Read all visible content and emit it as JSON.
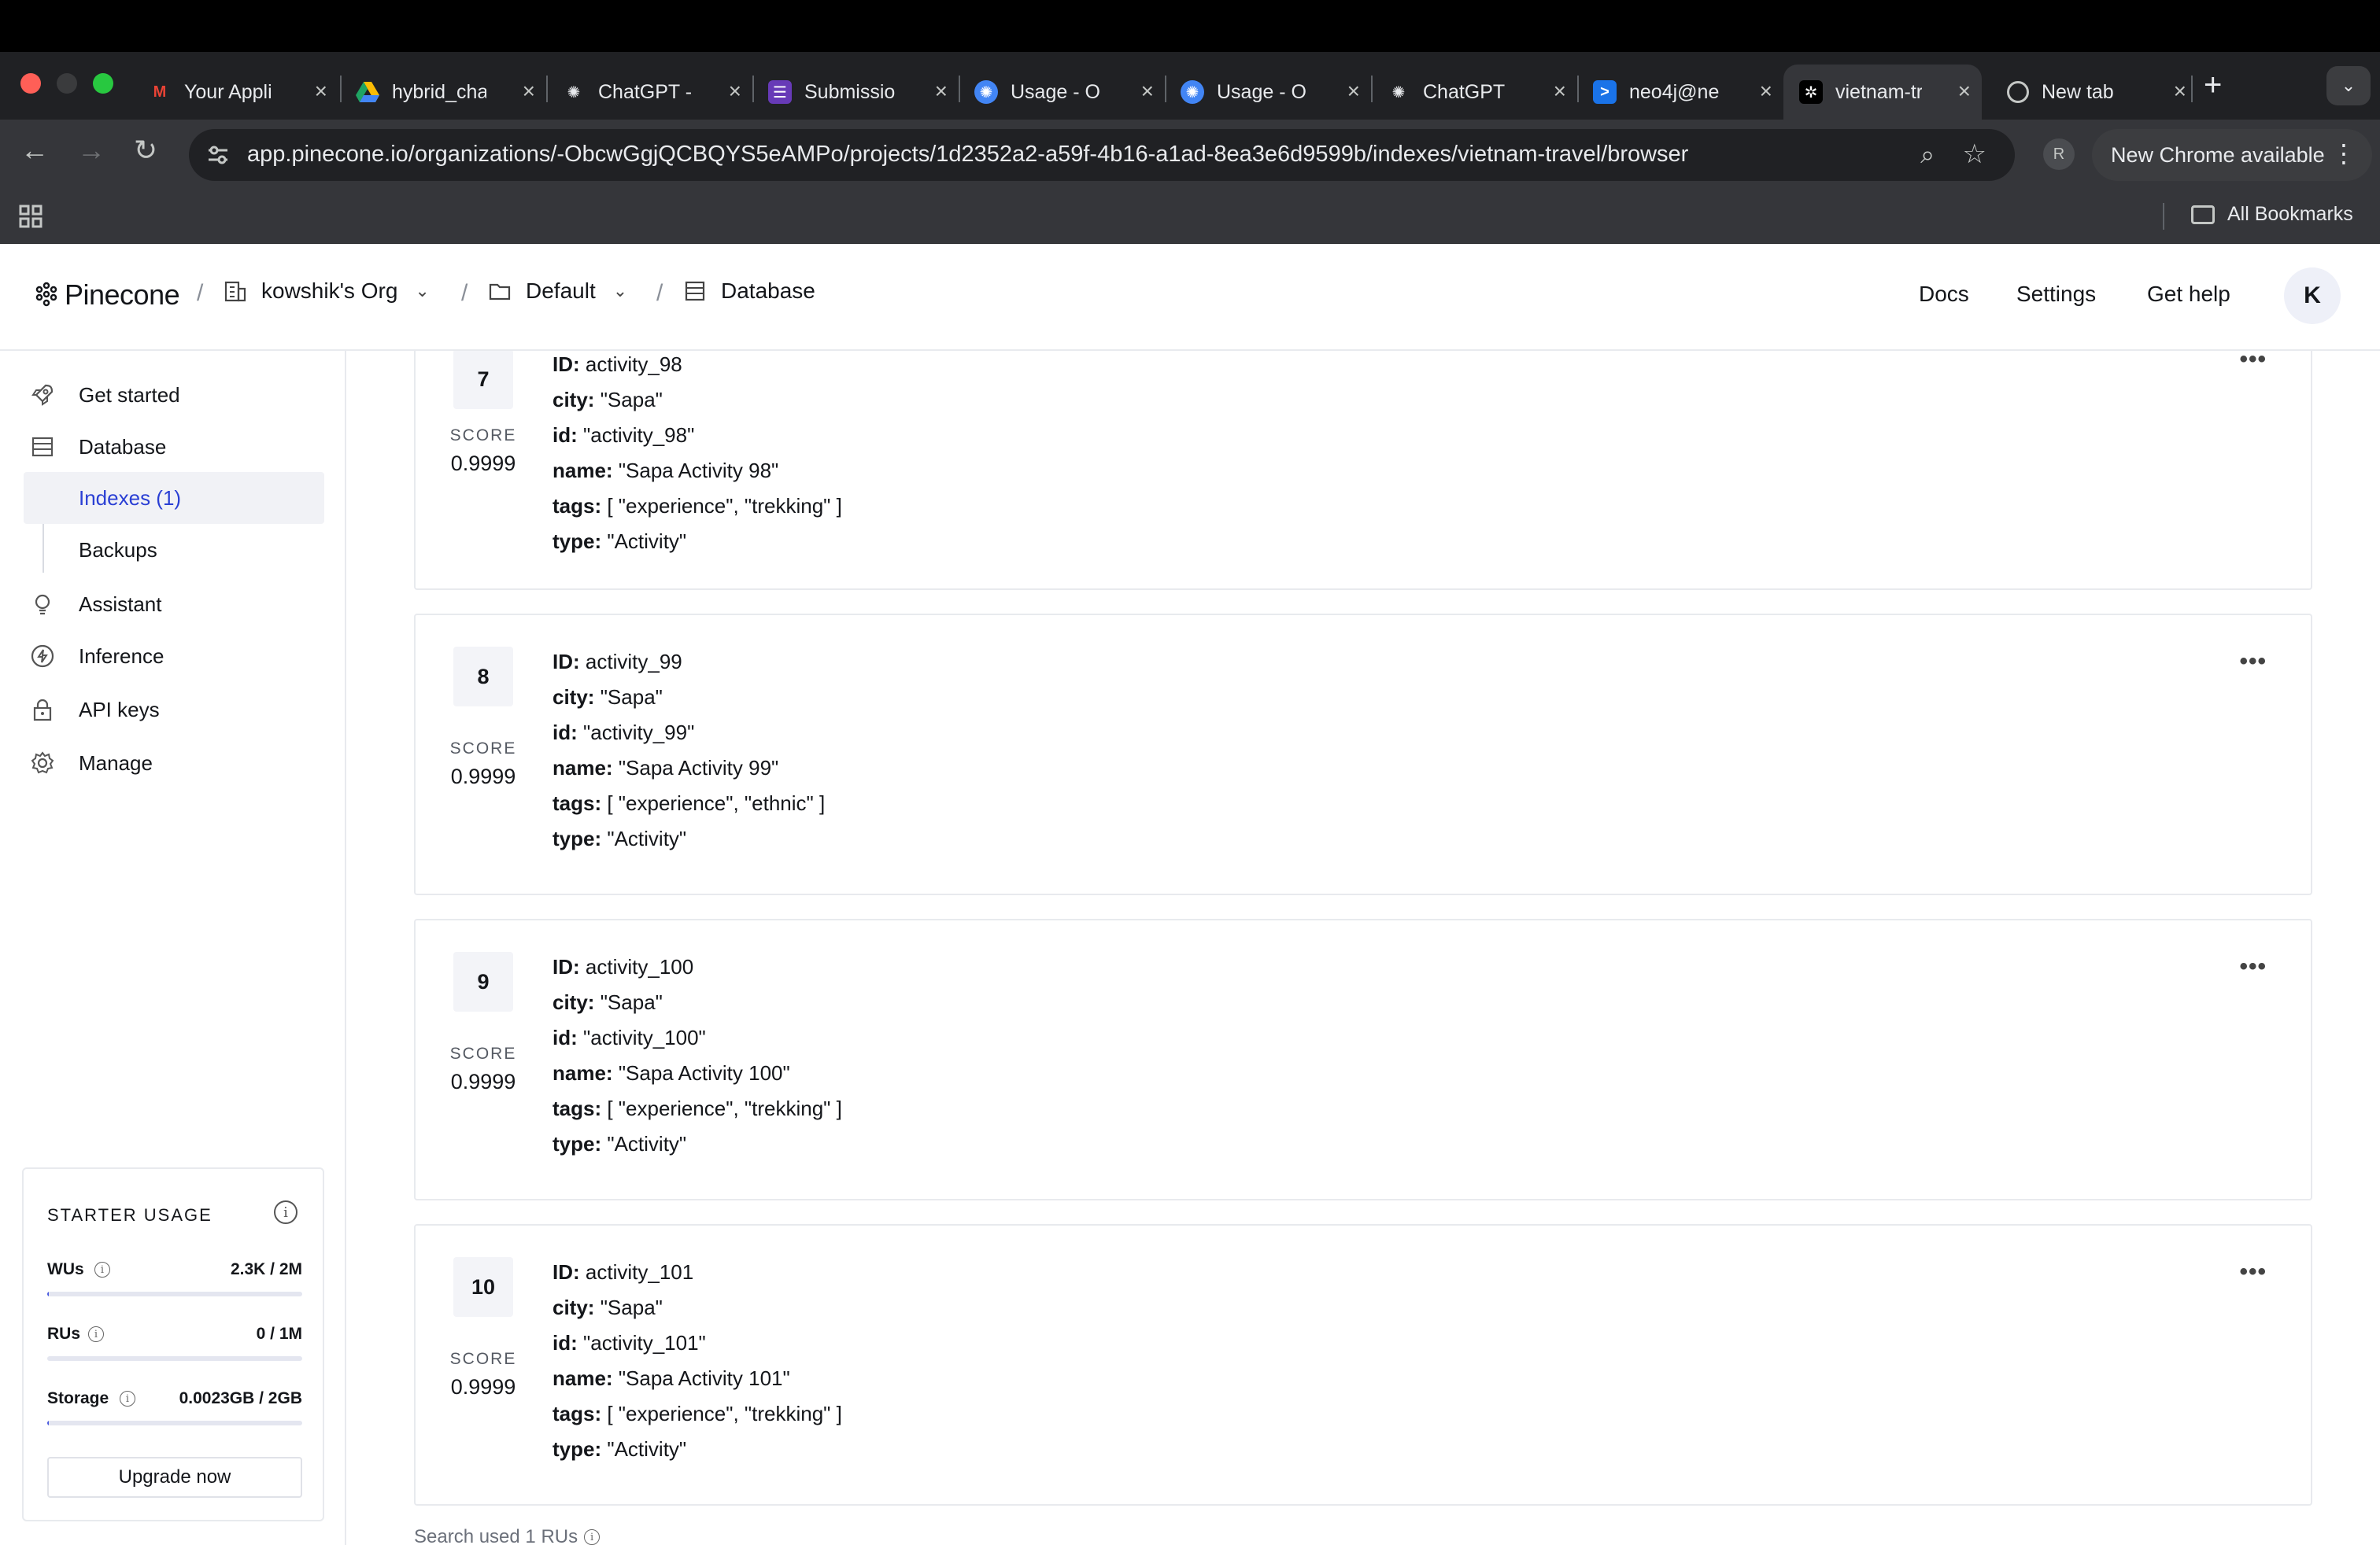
{
  "browser": {
    "tabs": [
      {
        "label": "Your Appli",
        "icon": "gmail-icon",
        "color": "#ea4335"
      },
      {
        "label": "hybrid_cha",
        "icon": "google-drive-icon",
        "color": "#1fa463"
      },
      {
        "label": "ChatGPT -",
        "icon": "chatgpt-icon",
        "color": "#e8eaed"
      },
      {
        "label": "Submissio",
        "icon": "forms-icon",
        "color": "#673ab7"
      },
      {
        "label": "Usage - O",
        "icon": "openai-icon",
        "color": "#4285f4"
      },
      {
        "label": "Usage - O",
        "icon": "openai-icon",
        "color": "#4285f4"
      },
      {
        "label": "ChatGPT",
        "icon": "chatgpt-icon",
        "color": "#e8eaed"
      },
      {
        "label": "neo4j@ne",
        "icon": "terminal-icon",
        "color": "#1a73e8"
      },
      {
        "label": "vietnam-tr",
        "icon": "pinecone-icon",
        "color": "#ffffff"
      },
      {
        "label": "New tab",
        "icon": "chrome-icon",
        "color": "#e8eaed"
      }
    ],
    "url": "app.pinecone.io/organizations/-ObcwGgjQCBQYS5eAMPo/projects/1d2352a2-a59f-4b16-a1ad-8ea3e6d9599b/indexes/vietnam-travel/browser",
    "profile_initial": "R",
    "update_label": "New Chrome available",
    "all_bookmarks": "All Bookmarks"
  },
  "header": {
    "logo": "Pinecone",
    "org": "kowshik's Org",
    "project": "Default",
    "section": "Database",
    "links": [
      "Docs",
      "Settings",
      "Get help"
    ],
    "avatar": "K"
  },
  "sidebar": {
    "items": [
      {
        "label": "Get started",
        "icon": "rocket-icon"
      },
      {
        "label": "Database",
        "icon": "database-icon"
      },
      {
        "label": "Assistant",
        "icon": "lightbulb-icon"
      },
      {
        "label": "Inference",
        "icon": "bolt-icon"
      },
      {
        "label": "API keys",
        "icon": "lock-icon"
      },
      {
        "label": "Manage",
        "icon": "gear-icon"
      }
    ],
    "subitems": [
      {
        "label": "Indexes (1)",
        "active": true
      },
      {
        "label": "Backups",
        "active": false
      }
    ]
  },
  "usage": {
    "title": "STARTER USAGE",
    "rows": [
      {
        "label": "WUs",
        "value": "2.3K / 2M",
        "fraction": 0.00115
      },
      {
        "label": "RUs",
        "value": "0 / 1M",
        "fraction": 0
      },
      {
        "label": "Storage",
        "value": "0.0023GB / 2GB",
        "fraction": 0.00115
      }
    ],
    "upgrade": "Upgrade now"
  },
  "records": [
    {
      "rank": "7",
      "score_label": "SCORE",
      "score": "0.9999",
      "id": "activity_98",
      "city": "\"Sapa\"",
      "id_field": "\"activity_98\"",
      "name": "\"Sapa Activity 98\"",
      "tags": "[ \"experience\", \"trekking\" ]",
      "type": "\"Activity\""
    },
    {
      "rank": "8",
      "score_label": "SCORE",
      "score": "0.9999",
      "id": "activity_99",
      "city": "\"Sapa\"",
      "id_field": "\"activity_99\"",
      "name": "\"Sapa Activity 99\"",
      "tags": "[ \"experience\", \"ethnic\" ]",
      "type": "\"Activity\""
    },
    {
      "rank": "9",
      "score_label": "SCORE",
      "score": "0.9999",
      "id": "activity_100",
      "city": "\"Sapa\"",
      "id_field": "\"activity_100\"",
      "name": "\"Sapa Activity 100\"",
      "tags": "[ \"experience\", \"trekking\" ]",
      "type": "\"Activity\""
    },
    {
      "rank": "10",
      "score_label": "SCORE",
      "score": "0.9999",
      "id": "activity_101",
      "city": "\"Sapa\"",
      "id_field": "\"activity_101\"",
      "name": "\"Sapa Activity 101\"",
      "tags": "[ \"experience\", \"trekking\" ]",
      "type": "\"Activity\""
    }
  ],
  "field_labels": {
    "ID": "ID:",
    "city": "city:",
    "id": "id:",
    "name": "name:",
    "tags": "tags:",
    "type": "type:"
  },
  "footer_note": "Search used 1 RUs"
}
